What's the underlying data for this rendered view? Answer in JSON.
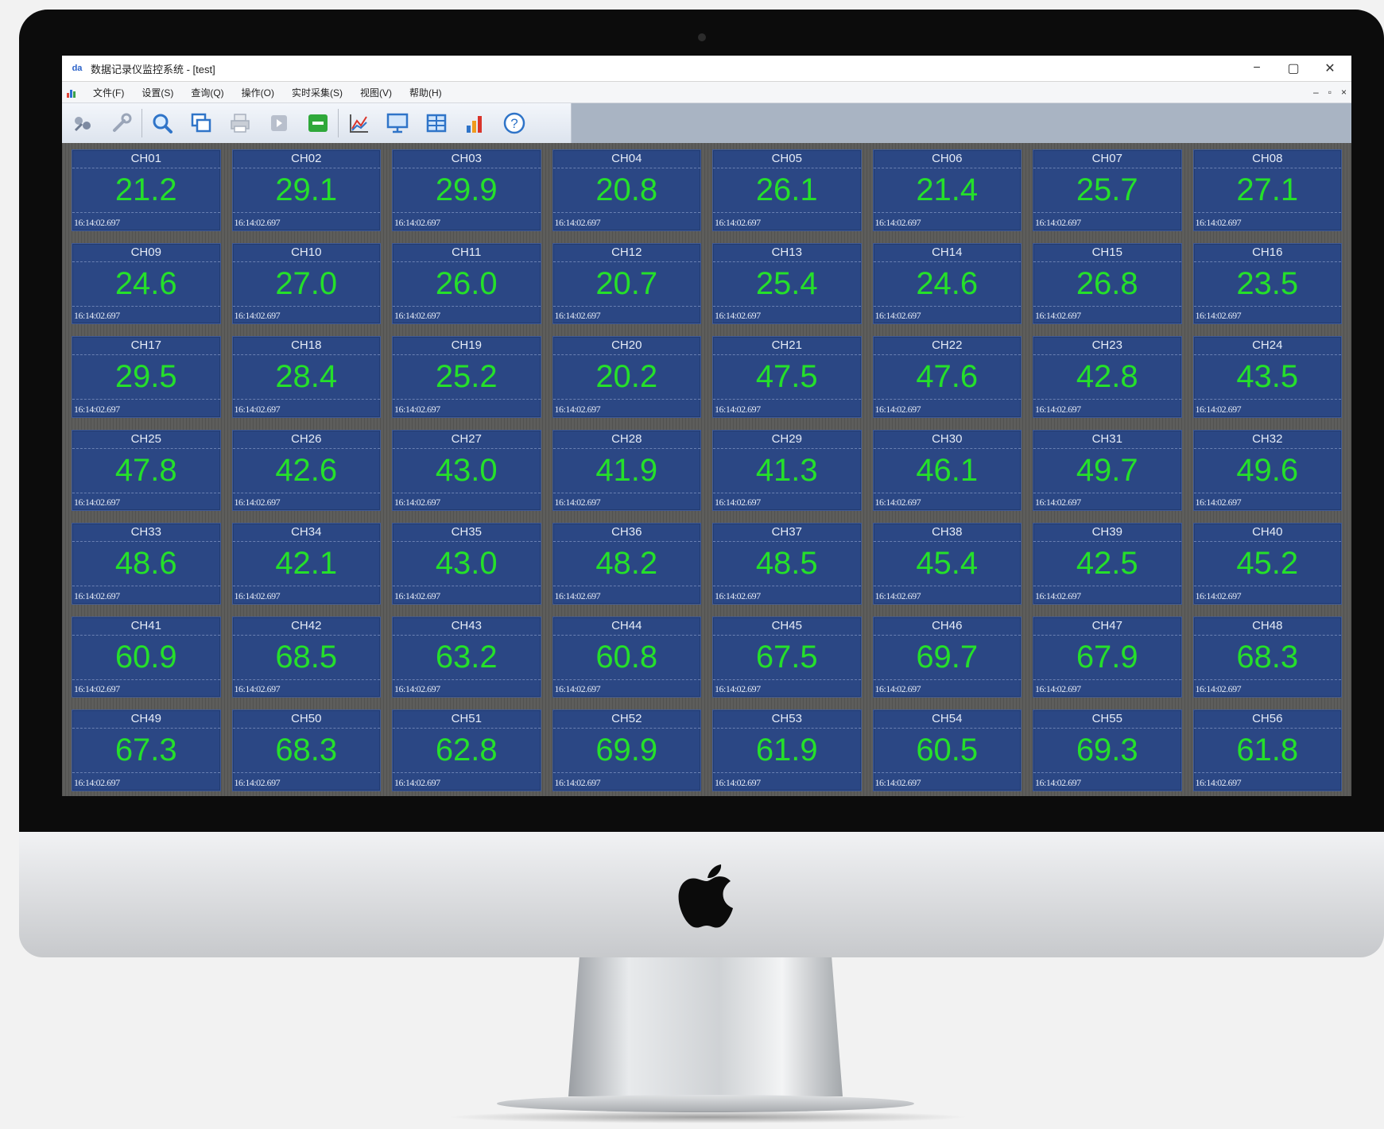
{
  "window": {
    "app_icon_text": "da",
    "title": "数据记录仪监控系统 - [test]",
    "controls": {
      "minimize": "−",
      "maximize": "▢",
      "close": "✕"
    }
  },
  "menu": {
    "items": [
      {
        "label": "文件(F)"
      },
      {
        "label": "设置(S)"
      },
      {
        "label": "查询(Q)"
      },
      {
        "label": "操作(O)"
      },
      {
        "label": "实时采集(S)"
      },
      {
        "label": "视图(V)"
      },
      {
        "label": "帮助(H)"
      }
    ],
    "mdi_controls": {
      "minimize": "–",
      "restore": "▫",
      "close": "×"
    }
  },
  "toolbar": {
    "buttons": [
      {
        "icon": "connect-icon"
      },
      {
        "icon": "tools-icon"
      },
      {
        "icon": "magnifier-icon"
      },
      {
        "icon": "copy-windows-icon"
      },
      {
        "icon": "printer-icon"
      },
      {
        "icon": "play-icon"
      },
      {
        "icon": "stop-icon"
      },
      {
        "icon": "line-chart-icon"
      },
      {
        "icon": "monitor-icon"
      },
      {
        "icon": "table-icon"
      },
      {
        "icon": "bar-chart-icon"
      },
      {
        "icon": "help-icon"
      }
    ]
  },
  "colors": {
    "tile_background": "#2b4784",
    "value_green": "#25e02a",
    "grid_background": "#5d5d5b"
  },
  "channels": [
    {
      "name": "CH01",
      "value": "21.2",
      "time": "16:14:02.697"
    },
    {
      "name": "CH02",
      "value": "29.1",
      "time": "16:14:02.697"
    },
    {
      "name": "CH03",
      "value": "29.9",
      "time": "16:14:02.697"
    },
    {
      "name": "CH04",
      "value": "20.8",
      "time": "16:14:02.697"
    },
    {
      "name": "CH05",
      "value": "26.1",
      "time": "16:14:02.697"
    },
    {
      "name": "CH06",
      "value": "21.4",
      "time": "16:14:02.697"
    },
    {
      "name": "CH07",
      "value": "25.7",
      "time": "16:14:02.697"
    },
    {
      "name": "CH08",
      "value": "27.1",
      "time": "16:14:02.697"
    },
    {
      "name": "CH09",
      "value": "24.6",
      "time": "16:14:02.697"
    },
    {
      "name": "CH10",
      "value": "27.0",
      "time": "16:14:02.697"
    },
    {
      "name": "CH11",
      "value": "26.0",
      "time": "16:14:02.697"
    },
    {
      "name": "CH12",
      "value": "20.7",
      "time": "16:14:02.697"
    },
    {
      "name": "CH13",
      "value": "25.4",
      "time": "16:14:02.697"
    },
    {
      "name": "CH14",
      "value": "24.6",
      "time": "16:14:02.697"
    },
    {
      "name": "CH15",
      "value": "26.8",
      "time": "16:14:02.697"
    },
    {
      "name": "CH16",
      "value": "23.5",
      "time": "16:14:02.697"
    },
    {
      "name": "CH17",
      "value": "29.5",
      "time": "16:14:02.697"
    },
    {
      "name": "CH18",
      "value": "28.4",
      "time": "16:14:02.697"
    },
    {
      "name": "CH19",
      "value": "25.2",
      "time": "16:14:02.697"
    },
    {
      "name": "CH20",
      "value": "20.2",
      "time": "16:14:02.697"
    },
    {
      "name": "CH21",
      "value": "47.5",
      "time": "16:14:02.697"
    },
    {
      "name": "CH22",
      "value": "47.6",
      "time": "16:14:02.697"
    },
    {
      "name": "CH23",
      "value": "42.8",
      "time": "16:14:02.697"
    },
    {
      "name": "CH24",
      "value": "43.5",
      "time": "16:14:02.697"
    },
    {
      "name": "CH25",
      "value": "47.8",
      "time": "16:14:02.697"
    },
    {
      "name": "CH26",
      "value": "42.6",
      "time": "16:14:02.697"
    },
    {
      "name": "CH27",
      "value": "43.0",
      "time": "16:14:02.697"
    },
    {
      "name": "CH28",
      "value": "41.9",
      "time": "16:14:02.697"
    },
    {
      "name": "CH29",
      "value": "41.3",
      "time": "16:14:02.697"
    },
    {
      "name": "CH30",
      "value": "46.1",
      "time": "16:14:02.697"
    },
    {
      "name": "CH31",
      "value": "49.7",
      "time": "16:14:02.697"
    },
    {
      "name": "CH32",
      "value": "49.6",
      "time": "16:14:02.697"
    },
    {
      "name": "CH33",
      "value": "48.6",
      "time": "16:14:02.697"
    },
    {
      "name": "CH34",
      "value": "42.1",
      "time": "16:14:02.697"
    },
    {
      "name": "CH35",
      "value": "43.0",
      "time": "16:14:02.697"
    },
    {
      "name": "CH36",
      "value": "48.2",
      "time": "16:14:02.697"
    },
    {
      "name": "CH37",
      "value": "48.5",
      "time": "16:14:02.697"
    },
    {
      "name": "CH38",
      "value": "45.4",
      "time": "16:14:02.697"
    },
    {
      "name": "CH39",
      "value": "42.5",
      "time": "16:14:02.697"
    },
    {
      "name": "CH40",
      "value": "45.2",
      "time": "16:14:02.697"
    },
    {
      "name": "CH41",
      "value": "60.9",
      "time": "16:14:02.697"
    },
    {
      "name": "CH42",
      "value": "68.5",
      "time": "16:14:02.697"
    },
    {
      "name": "CH43",
      "value": "63.2",
      "time": "16:14:02.697"
    },
    {
      "name": "CH44",
      "value": "60.8",
      "time": "16:14:02.697"
    },
    {
      "name": "CH45",
      "value": "67.5",
      "time": "16:14:02.697"
    },
    {
      "name": "CH46",
      "value": "69.7",
      "time": "16:14:02.697"
    },
    {
      "name": "CH47",
      "value": "67.9",
      "time": "16:14:02.697"
    },
    {
      "name": "CH48",
      "value": "68.3",
      "time": "16:14:02.697"
    },
    {
      "name": "CH49",
      "value": "67.3",
      "time": "16:14:02.697"
    },
    {
      "name": "CH50",
      "value": "68.3",
      "time": "16:14:02.697"
    },
    {
      "name": "CH51",
      "value": "62.8",
      "time": "16:14:02.697"
    },
    {
      "name": "CH52",
      "value": "69.9",
      "time": "16:14:02.697"
    },
    {
      "name": "CH53",
      "value": "61.9",
      "time": "16:14:02.697"
    },
    {
      "name": "CH54",
      "value": "60.5",
      "time": "16:14:02.697"
    },
    {
      "name": "CH55",
      "value": "69.3",
      "time": "16:14:02.697"
    },
    {
      "name": "CH56",
      "value": "61.8",
      "time": "16:14:02.697"
    }
  ]
}
